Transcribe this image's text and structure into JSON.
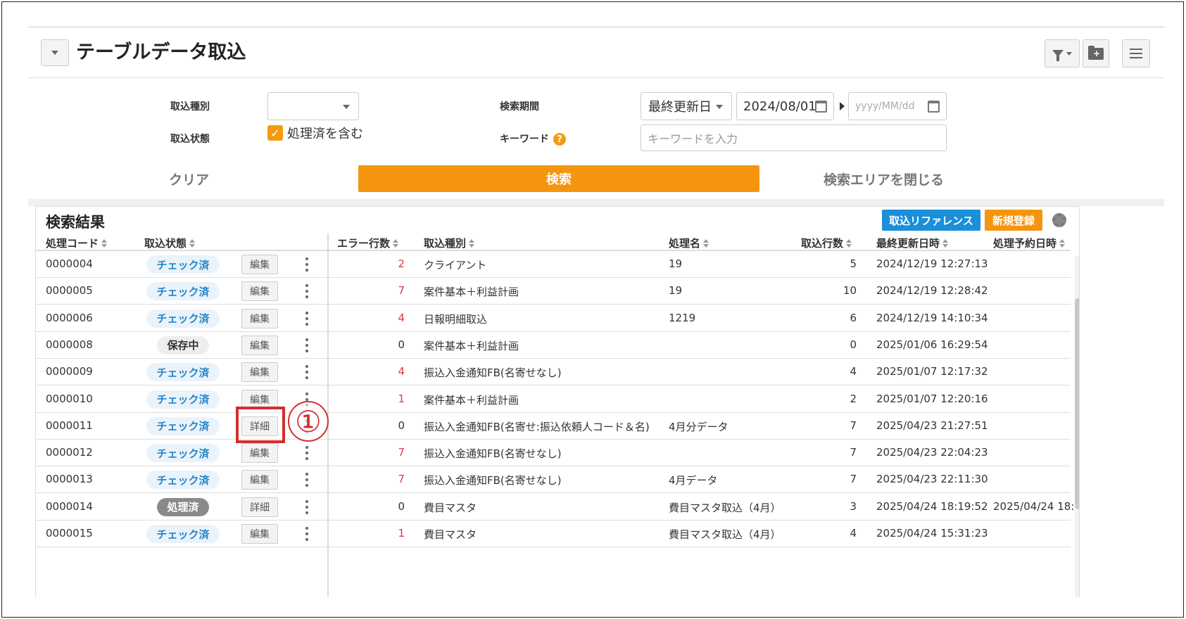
{
  "header": {
    "title": "テーブルデータ取込"
  },
  "form": {
    "import_type_label": "取込種別",
    "import_type_value": "",
    "import_status_label": "取込状態",
    "include_processed_label": "処理済を含む",
    "include_processed_checked": true,
    "period_label": "検索期間",
    "period_select_value": "最終更新日",
    "date_from": "2024/08/01",
    "date_to_placeholder": "yyyy/MM/dd",
    "keyword_label": "キーワード",
    "keyword_help": "?",
    "keyword_placeholder": "キーワードを入力"
  },
  "actions": {
    "clear": "クリア",
    "search": "検索",
    "close_area": "検索エリアを閉じる"
  },
  "results": {
    "title": "検索結果",
    "reference_button": "取込リファレンス",
    "new_button": "新規登録",
    "columns": {
      "code": "処理コード",
      "status": "取込状態",
      "errors": "エラー行数",
      "type": "取込種別",
      "name": "処理名",
      "rows": "取込行数",
      "updated": "最終更新日時",
      "scheduled": "処理予約日時"
    },
    "rows": [
      {
        "code": "0000004",
        "status": "チェック済",
        "status_kind": "check",
        "action": "編集",
        "errors": "2",
        "type": "クライアント",
        "name": "19",
        "rows": "5",
        "updated": "2024/12/19 12:27:13",
        "scheduled": ""
      },
      {
        "code": "0000005",
        "status": "チェック済",
        "status_kind": "check",
        "action": "編集",
        "errors": "7",
        "type": "案件基本＋利益計画",
        "name": "19",
        "rows": "10",
        "updated": "2024/12/19 12:28:42",
        "scheduled": ""
      },
      {
        "code": "0000006",
        "status": "チェック済",
        "status_kind": "check",
        "action": "編集",
        "errors": "4",
        "type": "日報明細取込",
        "name": "1219",
        "rows": "6",
        "updated": "2024/12/19 14:10:34",
        "scheduled": ""
      },
      {
        "code": "0000008",
        "status": "保存中",
        "status_kind": "save",
        "action": "編集",
        "errors": "0",
        "type": "案件基本＋利益計画",
        "name": "",
        "rows": "0",
        "updated": "2025/01/06 16:29:54",
        "scheduled": ""
      },
      {
        "code": "0000009",
        "status": "チェック済",
        "status_kind": "check",
        "action": "編集",
        "errors": "4",
        "type": "振込入金通知FB(名寄せなし)",
        "name": "",
        "rows": "4",
        "updated": "2025/01/07 12:17:32",
        "scheduled": ""
      },
      {
        "code": "0000010",
        "status": "チェック済",
        "status_kind": "check",
        "action": "編集",
        "errors": "1",
        "type": "案件基本＋利益計画",
        "name": "",
        "rows": "2",
        "updated": "2025/01/07 12:20:16",
        "scheduled": ""
      },
      {
        "code": "0000011",
        "status": "チェック済",
        "status_kind": "check",
        "action": "詳細",
        "errors": "0",
        "type": "振込入金通知FB(名寄せ:振込依頼人コード＆名)",
        "name": "4月分データ",
        "rows": "7",
        "updated": "2025/04/23 21:27:51",
        "scheduled": ""
      },
      {
        "code": "0000012",
        "status": "チェック済",
        "status_kind": "check",
        "action": "編集",
        "errors": "7",
        "type": "振込入金通知FB(名寄せなし)",
        "name": "",
        "rows": "7",
        "updated": "2025/04/23 22:04:23",
        "scheduled": ""
      },
      {
        "code": "0000013",
        "status": "チェック済",
        "status_kind": "check",
        "action": "編集",
        "errors": "7",
        "type": "振込入金通知FB(名寄せなし)",
        "name": "4月データ",
        "rows": "7",
        "updated": "2025/04/23 22:11:30",
        "scheduled": ""
      },
      {
        "code": "0000014",
        "status": "処理済",
        "status_kind": "done",
        "action": "詳細",
        "errors": "0",
        "type": "費目マスタ",
        "name": "費目マスタ取込（4月）",
        "rows": "3",
        "updated": "2025/04/24 18:19:52",
        "scheduled": "2025/04/24 18:"
      },
      {
        "code": "0000015",
        "status": "チェック済",
        "status_kind": "check",
        "action": "編集",
        "errors": "1",
        "type": "費目マスタ",
        "name": "費目マスタ取込（4月）",
        "rows": "4",
        "updated": "2025/04/24 15:31:23",
        "scheduled": ""
      }
    ]
  },
  "annotation": {
    "marker": "①"
  },
  "colors": {
    "accent_orange": "#f5950f",
    "accent_blue": "#1b8fd8",
    "error_red": "#e0344a",
    "annotation_red": "#d32f2f"
  }
}
